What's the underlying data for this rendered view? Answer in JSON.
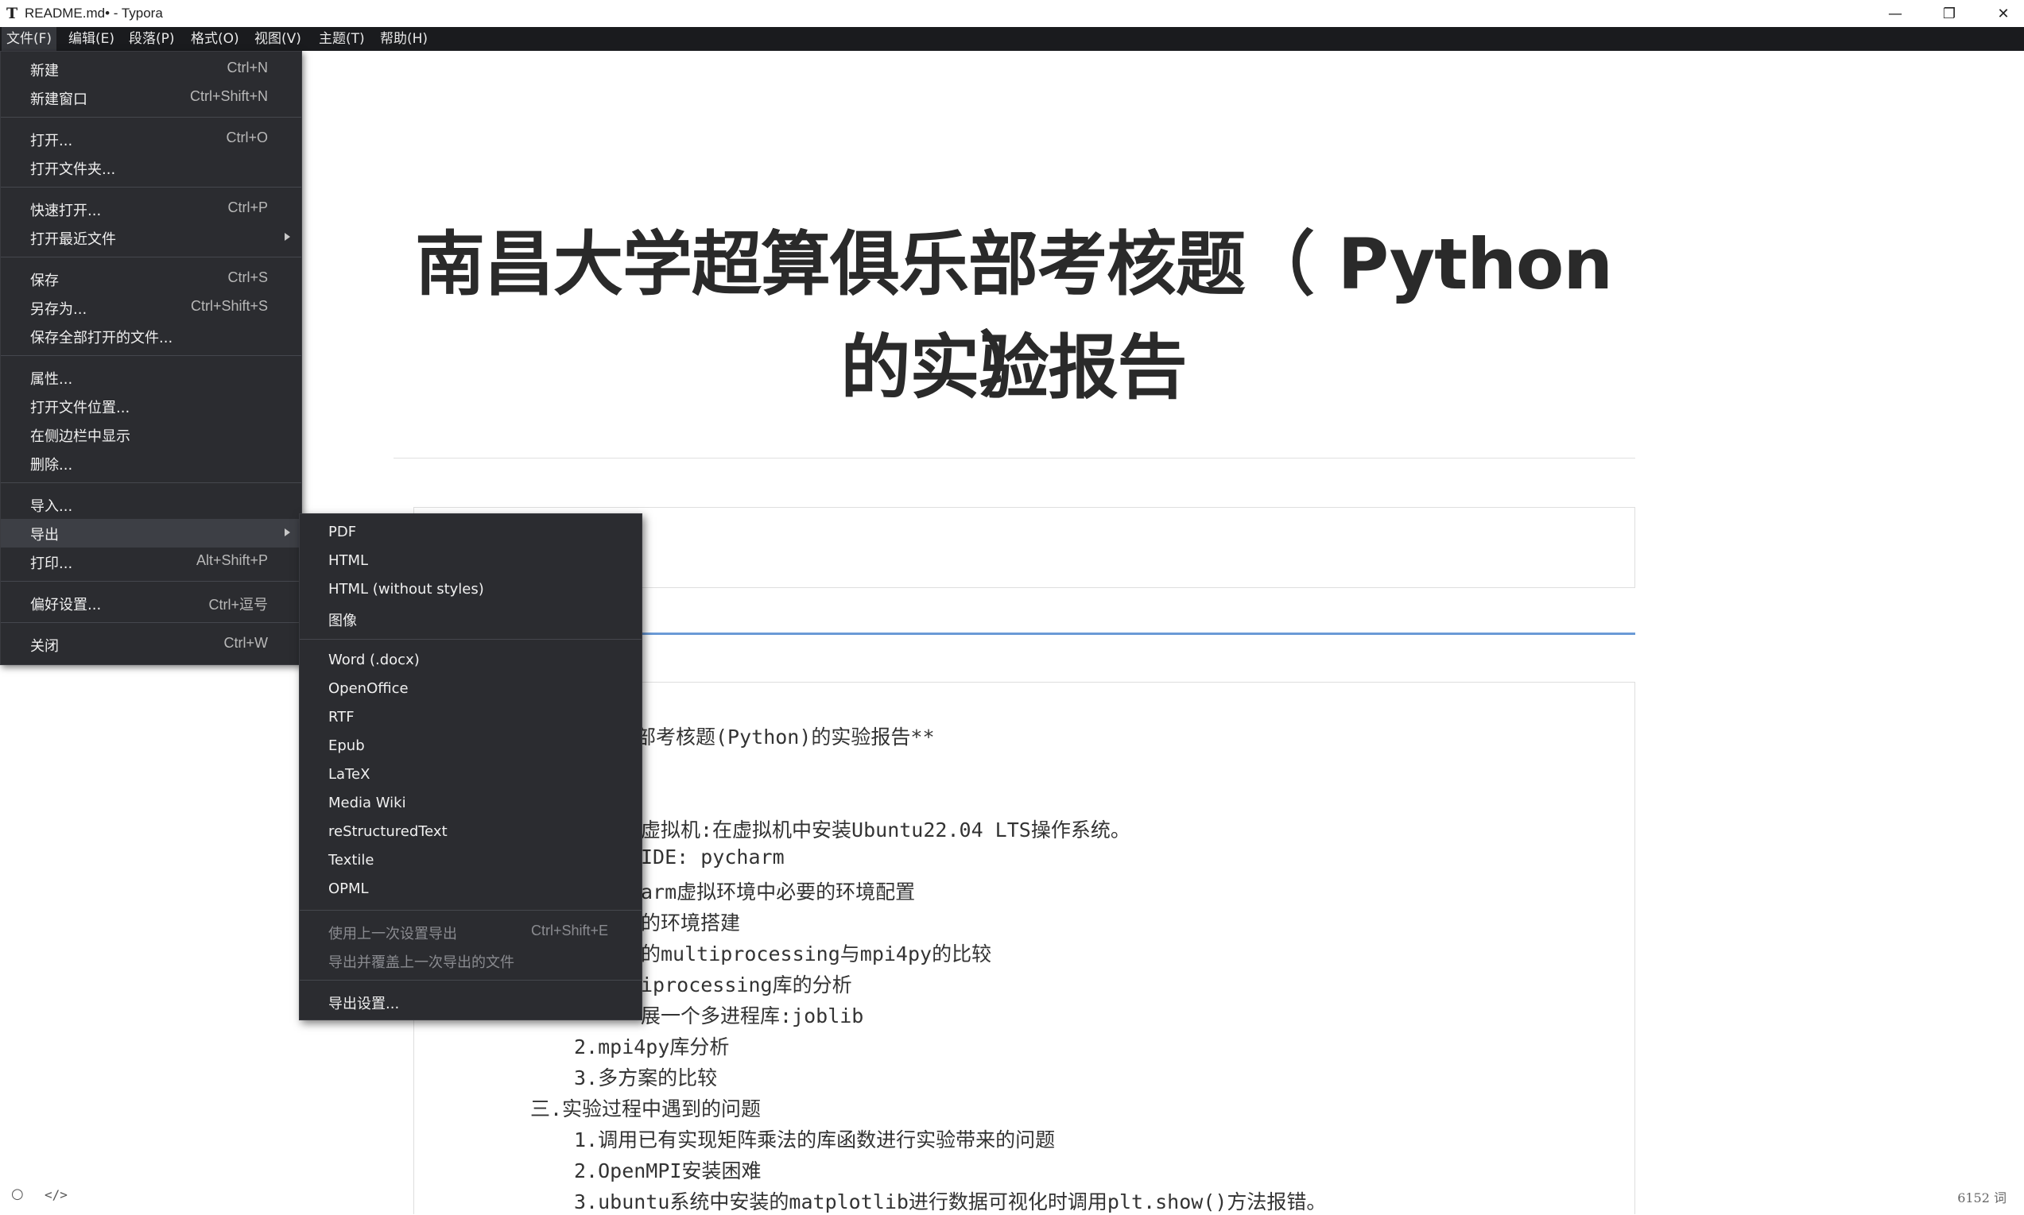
{
  "window": {
    "title": "README.md• - Typora",
    "minimize": "—",
    "maximize": "❐",
    "close": "✕"
  },
  "menubar": [
    "文件(F)",
    "编辑(E)",
    "段落(P)",
    "格式(O)",
    "视图(V)",
    "主题(T)",
    "帮助(H)"
  ],
  "document": {
    "heading_line1": "南昌大学超算俱乐部考核题（ Python ）",
    "heading_line2": "的实验报告",
    "code_lines": [
      "部考核题(Python)的实验报告**",
      "虚拟机:在虚拟机中安装Ubuntu22.04 LTS操作系统。",
      "IDE: pycharm",
      "arm虚拟环境中必要的环境配置",
      "的环境搭建",
      "的multiprocessing与mpi4py的比较",
      "iprocessing库的分析",
      "展一个多进程库:joblib",
      "2.mpi4py库分析",
      "3.多方案的比较",
      "三.实验过程中遇到的问题",
      "1.调用已有实现矩阵乘法的库函数进行实验带来的问题",
      "2.OpenMPI安装困难",
      "3.ubuntu系统中安装的matplotlib进行数据可视化时调用plt.show()方法报错。"
    ]
  },
  "file_menu": {
    "items": [
      {
        "label": "新建",
        "shortcut": "Ctrl+N"
      },
      {
        "label": "新建窗口",
        "shortcut": "Ctrl+Shift+N"
      },
      {
        "label": "打开...",
        "shortcut": "Ctrl+O"
      },
      {
        "label": "打开文件夹...",
        "shortcut": ""
      },
      {
        "label": "快速打开...",
        "shortcut": "Ctrl+P"
      },
      {
        "label": "打开最近文件",
        "shortcut": ""
      },
      {
        "label": "保存",
        "shortcut": "Ctrl+S"
      },
      {
        "label": "另存为...",
        "shortcut": "Ctrl+Shift+S"
      },
      {
        "label": "保存全部打开的文件...",
        "shortcut": ""
      },
      {
        "label": "属性...",
        "shortcut": ""
      },
      {
        "label": "打开文件位置...",
        "shortcut": ""
      },
      {
        "label": "在侧边栏中显示",
        "shortcut": ""
      },
      {
        "label": "删除...",
        "shortcut": ""
      },
      {
        "label": "导入...",
        "shortcut": ""
      },
      {
        "label": "导出",
        "shortcut": ""
      },
      {
        "label": "打印...",
        "shortcut": "Alt+Shift+P"
      },
      {
        "label": "偏好设置...",
        "shortcut": "Ctrl+逗号"
      },
      {
        "label": "关闭",
        "shortcut": "Ctrl+W"
      }
    ]
  },
  "export_menu": {
    "items": [
      {
        "label": "PDF",
        "shortcut": ""
      },
      {
        "label": "HTML",
        "shortcut": ""
      },
      {
        "label": "HTML (without styles)",
        "shortcut": ""
      },
      {
        "label": "图像",
        "shortcut": ""
      },
      {
        "label": "Word (.docx)",
        "shortcut": ""
      },
      {
        "label": "OpenOffice",
        "shortcut": ""
      },
      {
        "label": "RTF",
        "shortcut": ""
      },
      {
        "label": "Epub",
        "shortcut": ""
      },
      {
        "label": "LaTeX",
        "shortcut": ""
      },
      {
        "label": "Media Wiki",
        "shortcut": ""
      },
      {
        "label": "reStructuredText",
        "shortcut": ""
      },
      {
        "label": "Textile",
        "shortcut": ""
      },
      {
        "label": "OPML",
        "shortcut": ""
      },
      {
        "label": "使用上一次设置导出",
        "shortcut": "Ctrl+Shift+E"
      },
      {
        "label": "导出并覆盖上一次导出的文件",
        "shortcut": ""
      },
      {
        "label": "导出设置...",
        "shortcut": ""
      }
    ]
  },
  "status": {
    "circle_icon": "○",
    "code_icon": "</>",
    "word_count": "6152 词"
  }
}
